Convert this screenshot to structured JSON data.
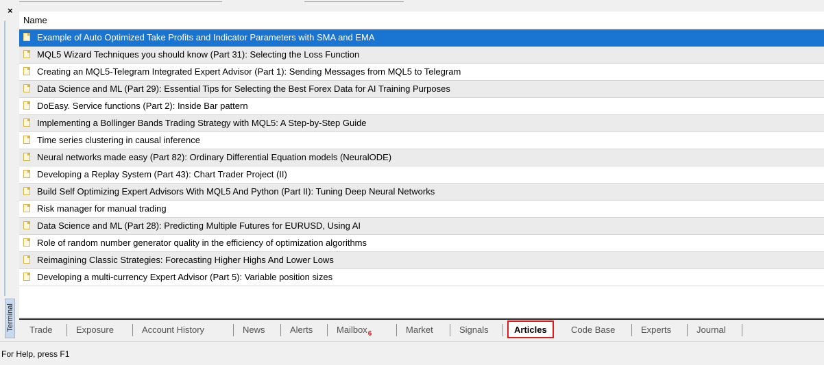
{
  "panel": {
    "close_glyph": "×",
    "side_tab_label": "Terminal",
    "column_header": "Name"
  },
  "articles": [
    "Example of Auto Optimized Take Profits and Indicator Parameters with SMA and EMA",
    "MQL5 Wizard Techniques you should know (Part 31): Selecting the Loss Function",
    "Creating an MQL5-Telegram Integrated Expert Advisor (Part 1): Sending Messages from MQL5 to Telegram",
    "Data Science and ML (Part 29): Essential Tips for Selecting the Best Forex Data for AI Training Purposes",
    "DoEasy. Service functions (Part 2): Inside Bar pattern",
    "Implementing a Bollinger Bands Trading Strategy with MQL5: A Step-by-Step Guide",
    "Time series clustering in causal inference",
    "Neural networks made easy (Part 82): Ordinary Differential Equation models (NeuralODE)",
    "Developing a Replay System (Part 43): Chart Trader Project (II)",
    "Build Self Optimizing Expert Advisors With MQL5 And Python (Part II): Tuning Deep Neural Networks",
    "Risk manager for manual trading",
    "Data Science and ML (Part 28): Predicting Multiple Futures for EURUSD, Using AI",
    "Role of random number generator quality in the efficiency of optimization algorithms",
    "Reimagining Classic Strategies: Forecasting Higher Highs And Lower Lows",
    "Developing a multi-currency Expert Advisor (Part 5): Variable position sizes"
  ],
  "tabs": {
    "trade": "Trade",
    "exposure": "Exposure",
    "account_history": "Account History",
    "news": "News",
    "alerts": "Alerts",
    "mailbox": "Mailbox",
    "mailbox_count": "6",
    "market": "Market",
    "signals": "Signals",
    "articles": "Articles",
    "code_base": "Code Base",
    "experts": "Experts",
    "journal": "Journal"
  },
  "status": {
    "help_text": "For Help, press F1"
  },
  "colors": {
    "selection": "#1a75d2",
    "active_tab_outline": "#e01b1b",
    "badge": "#d42020"
  }
}
